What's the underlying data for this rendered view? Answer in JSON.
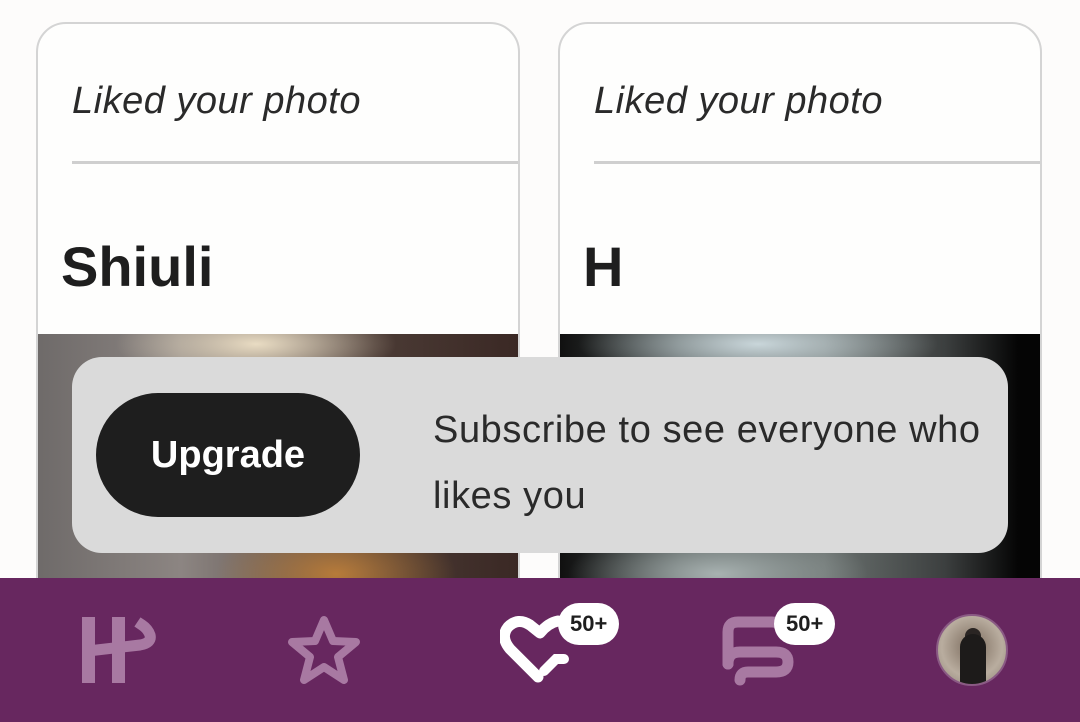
{
  "cards": [
    {
      "caption": "Liked your photo",
      "name": "Shiuli"
    },
    {
      "caption": "Liked your photo",
      "name": "H"
    }
  ],
  "banner": {
    "button_label": "Upgrade",
    "text": "Subscribe to see everyone who likes you"
  },
  "nav": {
    "items": [
      {
        "icon": "hinge-logo-icon"
      },
      {
        "icon": "star-icon"
      },
      {
        "icon": "heart-icon",
        "badge": "50+"
      },
      {
        "icon": "chat-icon",
        "badge": "50+"
      },
      {
        "icon": "profile-avatar"
      }
    ]
  },
  "colors": {
    "nav_background": "#67275f",
    "nav_icon_inactive": "#a879a2",
    "nav_icon_active": "#ffffff",
    "button_background": "#1e1e1e",
    "banner_background": "#dadada"
  }
}
